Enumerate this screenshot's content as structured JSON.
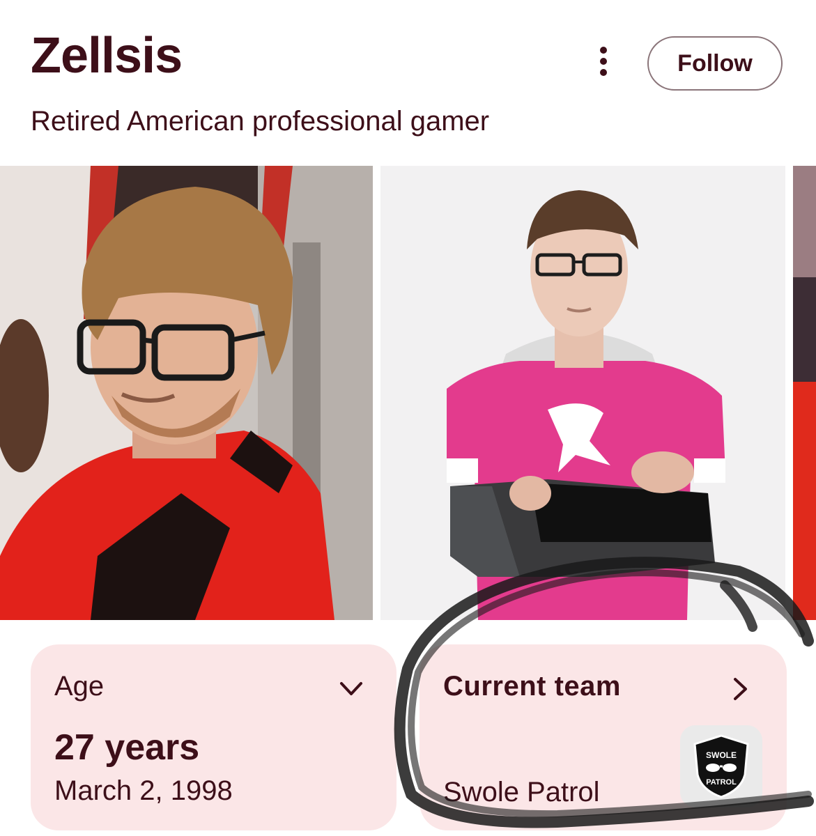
{
  "header": {
    "title": "Zellsis",
    "subtitle": "Retired American professional gamer",
    "more_icon": "more-vert-icon",
    "follow_label": "Follow"
  },
  "images": [
    {
      "name": "photo-player-red-jersey"
    },
    {
      "name": "photo-player-pink-jersey"
    },
    {
      "name": "photo-partial"
    }
  ],
  "cards": {
    "age": {
      "label": "Age",
      "value": "27 years",
      "date": "March 2, 1998",
      "icon": "chevron-down-icon"
    },
    "team": {
      "label": "Current team",
      "name": "Swole Patrol",
      "icon": "chevron-right-icon",
      "logo_text_top": "SWOLE",
      "logo_text_bottom": "PATROL"
    }
  },
  "colors": {
    "text": "#3d0f19",
    "card_bg": "#fbe6e7",
    "border": "#8a7479",
    "scribble": "#1a1a1a"
  }
}
